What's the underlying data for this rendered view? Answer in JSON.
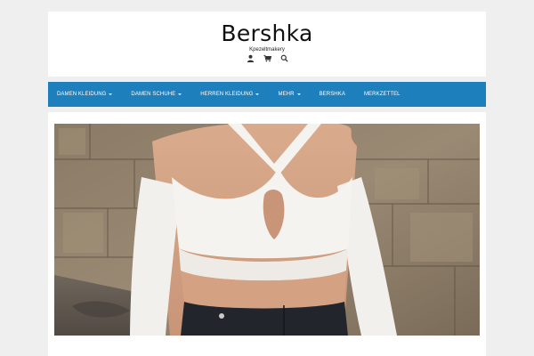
{
  "site": {
    "title": "Bershka",
    "tagline": "Kpezeltmakery"
  },
  "header_icons": [
    "user-icon",
    "cart-icon",
    "search-icon"
  ],
  "nav": {
    "items": [
      {
        "label": "Damen Kleidung",
        "has_dropdown": true
      },
      {
        "label": "Damen Schuhe",
        "has_dropdown": true
      },
      {
        "label": "Herren Kleidung",
        "has_dropdown": true
      },
      {
        "label": "Mehr",
        "has_dropdown": true
      },
      {
        "label": "Bershka",
        "has_dropdown": false
      },
      {
        "label": "Merkzettel",
        "has_dropdown": false
      }
    ]
  },
  "colors": {
    "page_background": "#efefef",
    "nav_background": "#1e7fbd",
    "nav_text": "#ffffff",
    "panel_background": "#ffffff"
  }
}
